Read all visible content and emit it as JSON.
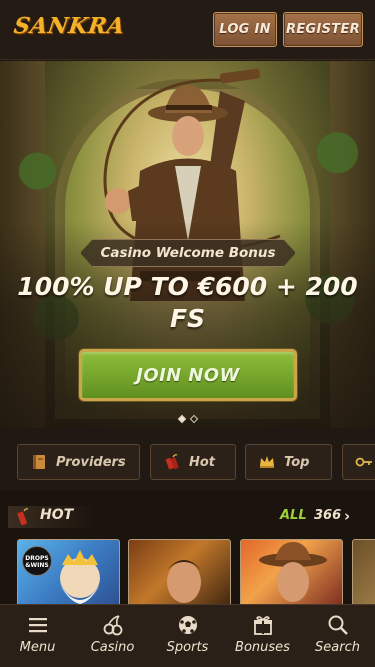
{
  "header": {
    "logo_text": "SANKRA",
    "login_label": "LOG IN",
    "register_label": "REGISTER"
  },
  "hero": {
    "bonus_tag": "Casino Welcome Bonus",
    "headline": "100% UP TO €600 + 200 FS",
    "cta_label": "JOIN NOW",
    "slide_count": 2,
    "active_slide": 1
  },
  "categories": [
    {
      "label": "Providers",
      "icon": "book-icon"
    },
    {
      "label": "Hot",
      "icon": "dynamite-icon"
    },
    {
      "label": "Top",
      "icon": "crown-icon"
    },
    {
      "label": "",
      "icon": "key-icon"
    }
  ],
  "hot_section": {
    "title": "HOT",
    "all_label": "ALL",
    "count": "366",
    "games": [
      {
        "badge": "DROPS &WINS"
      },
      {
        "badge": ""
      },
      {
        "badge": ""
      },
      {
        "badge": ""
      }
    ]
  },
  "bottom_nav": [
    {
      "label": "Menu",
      "icon": "hamburger-icon"
    },
    {
      "label": "Casino",
      "icon": "cherries-icon"
    },
    {
      "label": "Sports",
      "icon": "soccer-ball-icon"
    },
    {
      "label": "Bonuses",
      "icon": "gift-icon"
    },
    {
      "label": "Search",
      "icon": "search-icon"
    }
  ],
  "colors": {
    "brand_gold": "#f4b22a",
    "cta_green": "#7fae2f",
    "accent_green": "#9fd23a",
    "background": "#1e1712"
  }
}
